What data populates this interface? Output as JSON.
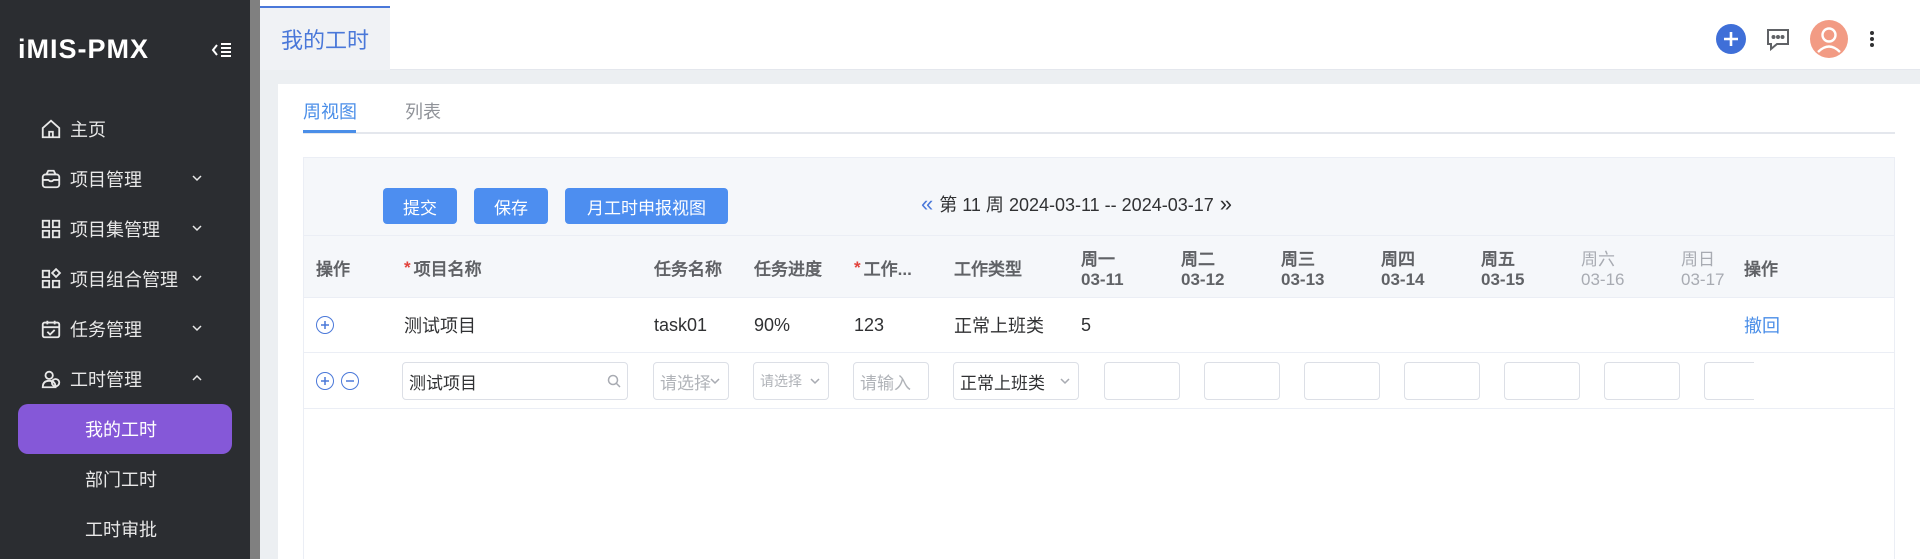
{
  "app": {
    "logo": "iMIS-PMX"
  },
  "sidebar": {
    "items": [
      {
        "label": "主页",
        "icon": "home-icon"
      },
      {
        "label": "项目管理",
        "icon": "box-icon",
        "expandable": true
      },
      {
        "label": "项目集管理",
        "icon": "grid-icon",
        "expandable": true
      },
      {
        "label": "项目组合管理",
        "icon": "apps-icon",
        "expandable": true
      },
      {
        "label": "任务管理",
        "icon": "calendar-check-icon",
        "expandable": true
      },
      {
        "label": "工时管理",
        "icon": "people-icon",
        "expandable": true,
        "expanded": true
      }
    ],
    "sub_items": [
      {
        "label": "我的工时",
        "active": true
      },
      {
        "label": "部门工时"
      },
      {
        "label": "工时审批"
      }
    ]
  },
  "header": {
    "page_tab": "我的工时"
  },
  "view_tabs": [
    {
      "label": "周视图",
      "active": true
    },
    {
      "label": "列表"
    }
  ],
  "toolbar": {
    "submit": "提交",
    "save": "保存",
    "monthly_view": "月工时申报视图",
    "week_label": "第 11 周 2024-03-11 -- 2024-03-17"
  },
  "table": {
    "headers": {
      "action": "操作",
      "project": "项目名称",
      "task": "任务名称",
      "progress": "任务进度",
      "work": "工作...",
      "work_type": "工作类型",
      "action_end": "操作"
    },
    "days": [
      {
        "name": "周一",
        "date": "03-11"
      },
      {
        "name": "周二",
        "date": "03-12"
      },
      {
        "name": "周三",
        "date": "03-13"
      },
      {
        "name": "周四",
        "date": "03-14"
      },
      {
        "name": "周五",
        "date": "03-15"
      },
      {
        "name": "周六",
        "date": "03-16",
        "weekend": true
      },
      {
        "name": "周日",
        "date": "03-17",
        "weekend": true
      }
    ],
    "row1": {
      "project": "测试项目",
      "task": "task01",
      "progress": "90%",
      "work": "123",
      "work_type": "正常上班类",
      "mon": "5",
      "action": "撤回"
    },
    "row2": {
      "project_value": "测试项目",
      "task_placeholder": "请选择",
      "progress_placeholder": "请选择",
      "work_placeholder": "请输入",
      "work_type_value": "正常上班类"
    }
  },
  "colors": {
    "accent": "#4a8ee8",
    "sidebar_bg": "#2b2d31",
    "active_menu": "#8558d8",
    "button": "#4d8ef0",
    "required": "#e2423b"
  }
}
